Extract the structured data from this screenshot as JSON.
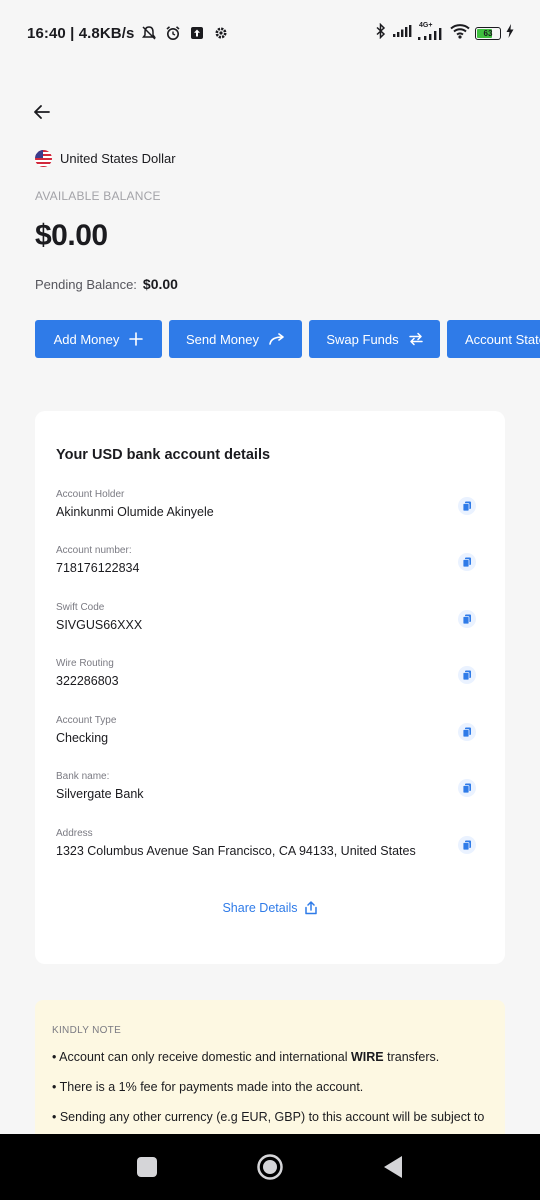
{
  "status_bar": {
    "time_speed": "16:40 | 4.8KB/s",
    "battery": "63",
    "network_label": "4G+"
  },
  "currency": {
    "name": "United States Dollar",
    "flag_icon": "us-flag-icon"
  },
  "balance": {
    "available_label": "AVAILABLE BALANCE",
    "amount": "$0.00",
    "pending_label": "Pending Balance:",
    "pending_amount": "$0.00"
  },
  "actions": [
    {
      "label": "Add Money",
      "icon": "plus-icon"
    },
    {
      "label": "Send Money",
      "icon": "send-arrow-icon"
    },
    {
      "label": "Swap Funds",
      "icon": "swap-icon"
    },
    {
      "label": "Account State",
      "icon": ""
    }
  ],
  "bank_card": {
    "title": "Your USD bank account details",
    "details": [
      {
        "label": "Account Holder",
        "value": "Akinkunmi Olumide Akinyele"
      },
      {
        "label": "Account number:",
        "value": "718176122834"
      },
      {
        "label": "Swift Code",
        "value": "SIVGUS66XXX"
      },
      {
        "label": "Wire Routing",
        "value": "322286803"
      },
      {
        "label": "Account Type",
        "value": "Checking"
      },
      {
        "label": "Bank name:",
        "value": "Silvergate Bank"
      },
      {
        "label": "Address",
        "value": "1323 Columbus Avenue San Francisco, CA 94133, United States"
      }
    ],
    "share_label": "Share Details"
  },
  "note": {
    "title": "KINDLY NOTE",
    "item1_prefix": "• Account can only receive domestic and international ",
    "item1_bold": "WIRE",
    "item1_suffix": " transfers.",
    "item2": "• There is a 1% fee for payments made into the account.",
    "item3": "• Sending any other currency (e.g EUR, GBP) to this account will be subject to"
  },
  "colors": {
    "accent": "#2f7be8",
    "background": "#f6f6f6",
    "note_background": "#fdf8e2"
  }
}
